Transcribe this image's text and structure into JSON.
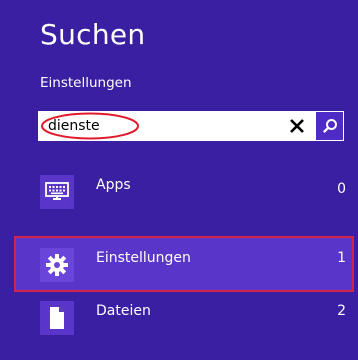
{
  "header": {
    "title": "Suchen",
    "scope": "Einstellungen"
  },
  "search": {
    "value": "dienste",
    "clear_icon": "close-icon",
    "submit_icon": "search-icon"
  },
  "results": [
    {
      "label": "Apps",
      "count": "0",
      "icon": "keyboard-icon"
    },
    {
      "label": "Einstellungen",
      "count": "1",
      "icon": "gear-icon"
    },
    {
      "label": "Dateien",
      "count": "2",
      "icon": "document-icon"
    }
  ],
  "colors": {
    "background": "#3b1fa3",
    "tile": "#5a35c9",
    "highlight": "#d4214a"
  }
}
